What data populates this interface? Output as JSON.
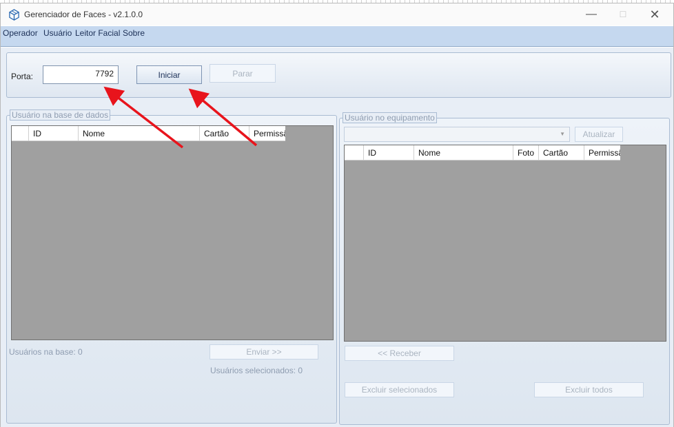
{
  "window": {
    "title": "Gerenciador de Faces - v2.1.0.0"
  },
  "menu": [
    "Operador",
    "Usuário",
    "Leitor Facial",
    "Sobre"
  ],
  "server": {
    "port_label": "Porta:",
    "port_value": "7792",
    "start_label": "Iniciar",
    "stop_label": "Parar"
  },
  "database_panel": {
    "title": "Usuário na base de dados",
    "columns": [
      "ID",
      "Nome",
      "Cartão",
      "Permissã"
    ],
    "count_text": "Usuários na base: 0",
    "send_label": "Enviar >>",
    "selected_text": "Usuários selecionados: 0"
  },
  "device_panel": {
    "title": "Usuário no equipamento",
    "device_select_value": "",
    "refresh_label": "Atualizar",
    "columns": [
      "ID",
      "Nome",
      "Foto",
      "Cartão",
      "Permissã"
    ],
    "receive_label": "<< Receber",
    "delete_selected_label": "Excluir selecionados",
    "delete_all_label": "Excluir todos"
  },
  "colors": {
    "menubar": "#c5d8ef",
    "grid_background": "#a0a0a0",
    "annotation_arrow": "#e8141c"
  }
}
